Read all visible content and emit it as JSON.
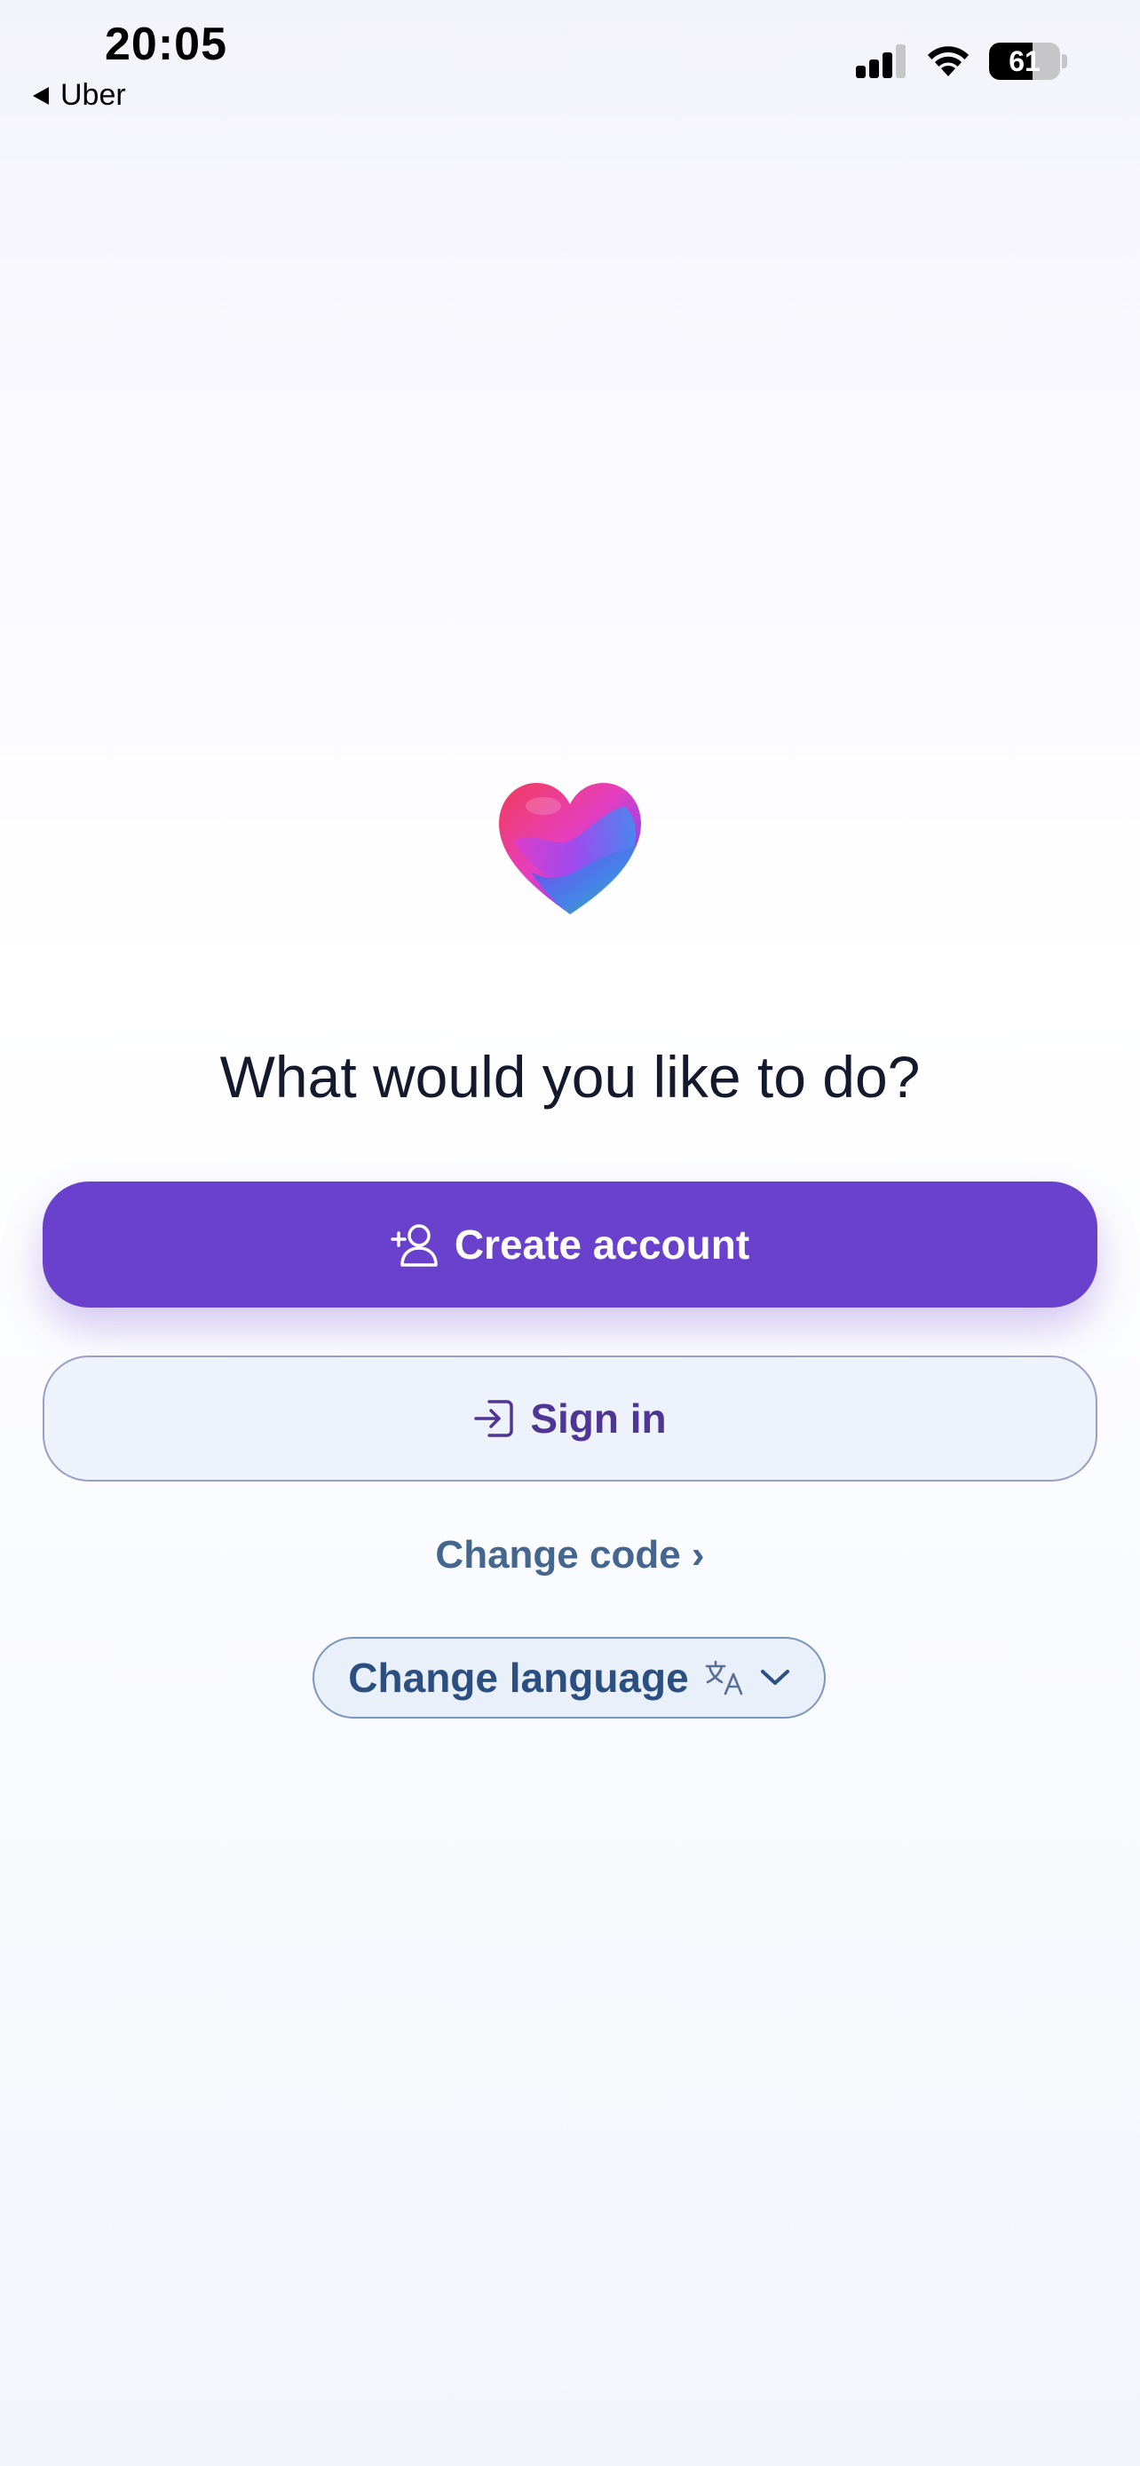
{
  "status_bar": {
    "time": "20:05",
    "back_label": "Uber",
    "battery_level": "61",
    "battery_fraction": 0.61,
    "icons": [
      "cellular-signal-icon",
      "wifi-icon",
      "battery-icon"
    ]
  },
  "main": {
    "heading": "What would you like to do?",
    "create_account_label": "Create account",
    "sign_in_label": "Sign in",
    "change_code_label": "Change code ›",
    "change_language_label": "Change language"
  },
  "icons": {
    "logo": "heart-logo-icon",
    "create_account": "add-user-icon",
    "sign_in": "sign-in-icon",
    "change_language": "translate-icon",
    "dropdown": "chevron-down-icon"
  },
  "colors": {
    "primary": "#6941cc",
    "secondary_bg": "#eef2fa",
    "secondary_text": "#4f3596",
    "link": "#45668f",
    "pill_text": "#2a4f80"
  }
}
